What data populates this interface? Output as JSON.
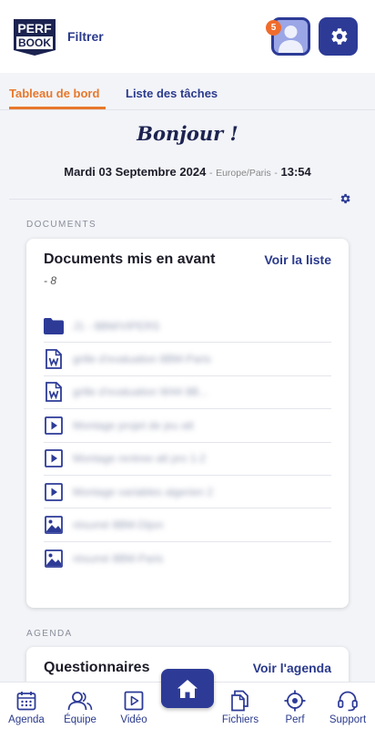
{
  "header": {
    "logo_line1": "PERF",
    "logo_line2": "BOOK",
    "filter_label": "Filtrer",
    "notification_count": "5"
  },
  "tabs": [
    {
      "label": "Tableau de bord",
      "active": true
    },
    {
      "label": "Liste des tâches",
      "active": false
    }
  ],
  "greeting": "Bonjour !",
  "dateline": {
    "date": "Mardi 03 Septembre 2024",
    "separator": "-",
    "timezone": "Europe/Paris",
    "time": "13:54"
  },
  "documents_section": {
    "label": "DOCUMENTS",
    "card_title": "Documents mis en avant",
    "link_label": "Voir la liste",
    "count": "- 8",
    "items": [
      {
        "icon": "folder-icon",
        "name": "J1 - 8BM/VIPERS"
      },
      {
        "icon": "word-file-icon",
        "name": "grille d'evaluation 8BM-Paris"
      },
      {
        "icon": "word-file-icon",
        "name": "grille d'evaluation W44 8B..."
      },
      {
        "icon": "video-file-icon",
        "name": "Montage projet de jeu att"
      },
      {
        "icon": "video-file-icon",
        "name": "Montage rentree att pro 1-2"
      },
      {
        "icon": "video-file-icon",
        "name": "Montage variables algerien 2"
      },
      {
        "icon": "image-file-icon",
        "name": "résumé 8BM-Dijon"
      },
      {
        "icon": "image-file-icon",
        "name": "résumé 8BM-Paris"
      }
    ]
  },
  "agenda_section": {
    "label": "AGENDA",
    "card_title": "Questionnaires",
    "link_label": "Voir l'agenda"
  },
  "bottom_nav": {
    "items": [
      {
        "label": "Agenda",
        "icon": "calendar-icon"
      },
      {
        "label": "Équipe",
        "icon": "team-icon"
      },
      {
        "label": "Vidéo",
        "icon": "video-icon"
      },
      {
        "label": "Fichiers",
        "icon": "files-icon"
      },
      {
        "label": "Perf",
        "icon": "target-icon"
      },
      {
        "label": "Support",
        "icon": "headset-icon"
      }
    ],
    "home_icon": "home-icon"
  },
  "colors": {
    "primary": "#2d3b97",
    "accent": "#e8782b",
    "badge": "#ef6c2d",
    "background": "#f3f4f8"
  }
}
